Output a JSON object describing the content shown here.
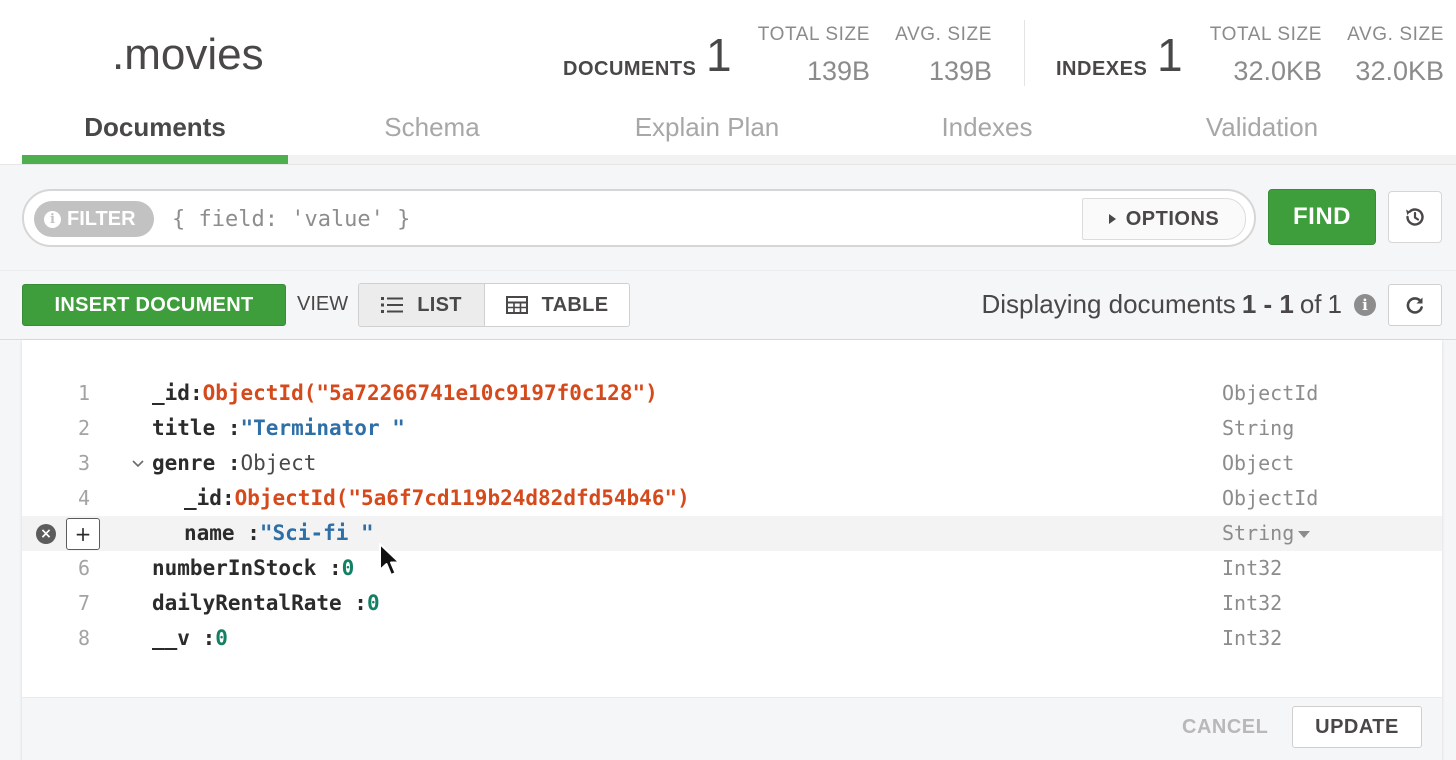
{
  "header": {
    "namespace": ".movies",
    "documents": {
      "label": "DOCUMENTS",
      "count": "1",
      "total_size_label": "TOTAL SIZE",
      "total_size": "139B",
      "avg_size_label": "AVG. SIZE",
      "avg_size": "139B"
    },
    "indexes": {
      "label": "INDEXES",
      "count": "1",
      "total_size_label": "TOTAL SIZE",
      "total_size": "32.0KB",
      "avg_size_label": "AVG. SIZE",
      "avg_size": "32.0KB"
    }
  },
  "tabs": [
    {
      "label": "Documents",
      "active": true
    },
    {
      "label": "Schema",
      "active": false
    },
    {
      "label": "Explain Plan",
      "active": false
    },
    {
      "label": "Indexes",
      "active": false
    },
    {
      "label": "Validation",
      "active": false
    }
  ],
  "query_bar": {
    "filter_label": "FILTER",
    "filter_placeholder": "{ field: 'value' }",
    "options_label": "OPTIONS",
    "find_label": "FIND",
    "reset_icon": "history-icon"
  },
  "toolbar": {
    "insert_label": "INSERT DOCUMENT",
    "view_label": "VIEW",
    "list_label": "LIST",
    "table_label": "TABLE",
    "displaying_prefix": "Displaying documents",
    "range": "1 - 1",
    "of_label": "of",
    "total": "1",
    "refresh_icon": "refresh-icon"
  },
  "document": {
    "rows": [
      {
        "line": "1",
        "key": "_id",
        "sep": ":",
        "value": "ObjectId(\"5a72266741e10c9197f0c128\")",
        "type": "ObjectId"
      },
      {
        "line": "2",
        "key": "title",
        "sep": " :",
        "value": "\"Terminator \"",
        "type": "String"
      },
      {
        "line": "3",
        "key": "genre",
        "sep": " :",
        "value": "Object",
        "type": "Object",
        "expander": "expanded"
      },
      {
        "line": "4",
        "key": "_id",
        "sep": ":",
        "value": "ObjectId(\"5a6f7cd119b24d82dfd54b46\")",
        "type": "ObjectId"
      },
      {
        "line": "",
        "key": "name",
        "sep": " :",
        "value": "\"Sci-fi \"",
        "type": "String"
      },
      {
        "line": "6",
        "key": "numberInStock",
        "sep": " :",
        "value": "0",
        "type": "Int32"
      },
      {
        "line": "7",
        "key": "dailyRentalRate",
        "sep": " :",
        "value": "0",
        "type": "Int32"
      },
      {
        "line": "8",
        "key": "__v",
        "sep": " :",
        "value": "0",
        "type": "Int32"
      }
    ],
    "cancel_label": "CANCEL",
    "update_label": "UPDATE",
    "row_add_symbol": "+",
    "row_delete_symbol": "×"
  }
}
